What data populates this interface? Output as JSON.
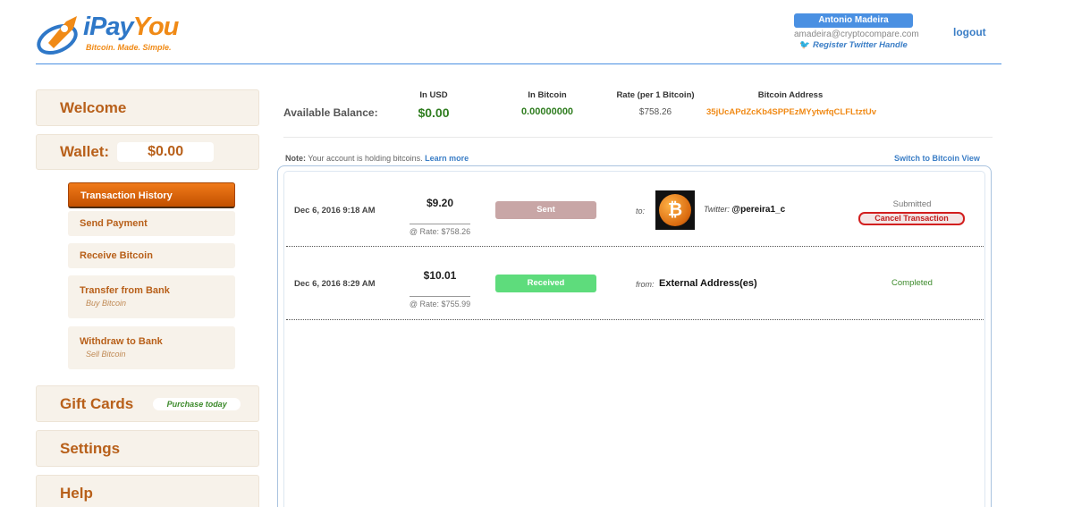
{
  "header": {
    "logo_text_i": "iPay",
    "logo_text_you": "You",
    "tagline": "Bitcoin. Made. Simple.",
    "user_name": "Antonio Madeira",
    "user_email": "amadeira@cryptocompare.com",
    "twitter_link": "Register Twitter Handle",
    "logout": "logout"
  },
  "sidebar": {
    "welcome": "Welcome",
    "wallet": "Wallet:",
    "wallet_amount": "$0.00",
    "items": [
      {
        "label": "Transaction History",
        "note": ""
      },
      {
        "label": "Send Payment",
        "note": ""
      },
      {
        "label": "Receive Bitcoin",
        "note": ""
      },
      {
        "label": "Transfer from Bank",
        "note": "Buy Bitcoin"
      },
      {
        "label": "Withdraw to Bank",
        "note": "Sell Bitcoin"
      }
    ],
    "gift_cards": "Gift Cards",
    "gift_pill": "Purchase today",
    "settings": "Settings",
    "help": "Help"
  },
  "balance": {
    "label": "Available Balance:",
    "usd_head": "In USD",
    "usd_value": "$0.00",
    "btc_head": "In Bitcoin",
    "btc_value": "0.00000000",
    "rate_head": "Rate (per 1 Bitcoin)",
    "rate_value": "$758.26",
    "addr_head": "Bitcoin Address",
    "addr_value": "35jUcAPdZcKb4SPPEzMYytwfqCLFLtztUv"
  },
  "note": {
    "prefix": "Note:",
    "text": "Your account is holding bitcoins.",
    "learn_more": "Learn more",
    "switch_view": "Switch to Bitcoin View"
  },
  "transactions": [
    {
      "date": "Dec 6, 2016 9:18 AM",
      "amount": "$9.20",
      "rate": "@ Rate: $758.26",
      "type": "Sent",
      "direction": "to:",
      "party_prefix": "Twitter:",
      "party": "@pereira1_c",
      "state": "Submitted",
      "action": "Cancel Transaction"
    },
    {
      "date": "Dec 6, 2016 8:29 AM",
      "amount": "$10.01",
      "rate": "@ Rate: $755.99",
      "type": "Received",
      "direction": "from:",
      "party": "External Address(es)",
      "state": "Completed"
    }
  ],
  "colors": {
    "brand_orange": "#f08a16",
    "brand_blue": "#2f78c8",
    "sent": "#c8a6a6",
    "received": "#5edc7c",
    "cancel": "#d21f1f"
  },
  "icons": [
    "rocket-logo-icon",
    "twitter-bird-icon",
    "bitcoin-avatar-icon"
  ]
}
